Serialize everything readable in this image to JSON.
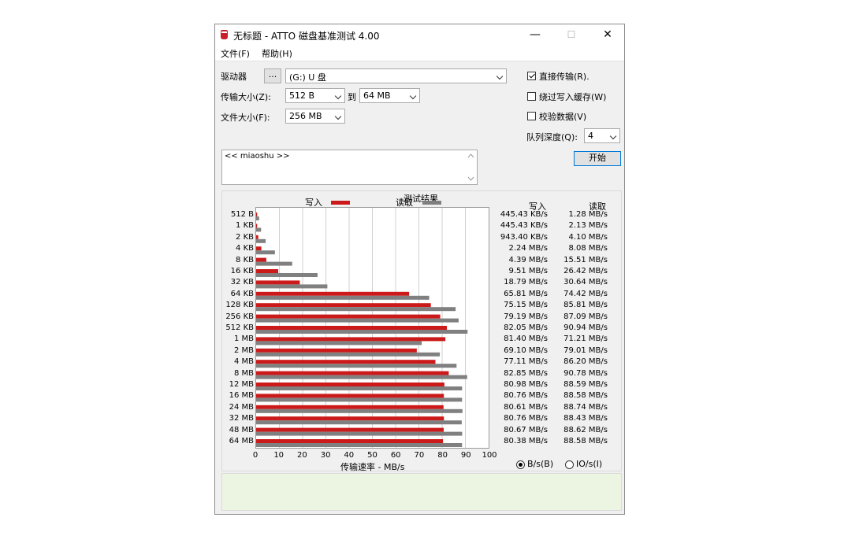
{
  "window": {
    "title": "无标题 - ATTO 磁盘基准测试 4.00",
    "minimize_glyph": "—",
    "maximize_glyph": "☐",
    "close_glyph": "✕"
  },
  "menu": {
    "file": "文件(F)",
    "help": "帮助(H)"
  },
  "drive": {
    "label": "驱动器",
    "browse": "...",
    "value": "(G:) U 盘"
  },
  "transfer": {
    "label": "传输大小(Z):",
    "from": "512 B",
    "to_label": "到",
    "to": "64 MB"
  },
  "filesize": {
    "label": "文件大小(F):",
    "value": "256 MB"
  },
  "options": {
    "direct_io": {
      "label": "直接传输(R).",
      "checked": true
    },
    "bypass_cache": {
      "label": "绕过写入缓存(W)",
      "checked": false
    },
    "verify": {
      "label": "校验数据(V)",
      "checked": false
    },
    "queue_label": "队列深度(Q):",
    "queue_value": "4"
  },
  "start_button": "开始",
  "description": "<< miaoshu >>",
  "colors": {
    "write": "#cc1a1a",
    "read": "#808080"
  },
  "results": {
    "write_header": "写入",
    "read_header": "读取",
    "rows": [
      {
        "size": "512 B",
        "write": "445.43 KB/s",
        "read": "1.28 MB/s"
      },
      {
        "size": "1 KB",
        "write": "445.43 KB/s",
        "read": "2.13 MB/s"
      },
      {
        "size": "2 KB",
        "write": "943.40 KB/s",
        "read": "4.10 MB/s"
      },
      {
        "size": "4 KB",
        "write": "2.24 MB/s",
        "read": "8.08 MB/s"
      },
      {
        "size": "8 KB",
        "write": "4.39 MB/s",
        "read": "15.51 MB/s"
      },
      {
        "size": "16 KB",
        "write": "9.51 MB/s",
        "read": "26.42 MB/s"
      },
      {
        "size": "32 KB",
        "write": "18.79 MB/s",
        "read": "30.64 MB/s"
      },
      {
        "size": "64 KB",
        "write": "65.81 MB/s",
        "read": "74.42 MB/s"
      },
      {
        "size": "128 KB",
        "write": "75.15 MB/s",
        "read": "85.81 MB/s"
      },
      {
        "size": "256 KB",
        "write": "79.19 MB/s",
        "read": "87.09 MB/s"
      },
      {
        "size": "512 KB",
        "write": "82.05 MB/s",
        "read": "90.94 MB/s"
      },
      {
        "size": "1 MB",
        "write": "81.40 MB/s",
        "read": "71.21 MB/s"
      },
      {
        "size": "2 MB",
        "write": "69.10 MB/s",
        "read": "79.01 MB/s"
      },
      {
        "size": "4 MB",
        "write": "77.11 MB/s",
        "read": "86.20 MB/s"
      },
      {
        "size": "8 MB",
        "write": "82.85 MB/s",
        "read": "90.78 MB/s"
      },
      {
        "size": "12 MB",
        "write": "80.98 MB/s",
        "read": "88.59 MB/s"
      },
      {
        "size": "16 MB",
        "write": "80.76 MB/s",
        "read": "88.58 MB/s"
      },
      {
        "size": "24 MB",
        "write": "80.61 MB/s",
        "read": "88.74 MB/s"
      },
      {
        "size": "32 MB",
        "write": "80.76 MB/s",
        "read": "88.43 MB/s"
      },
      {
        "size": "48 MB",
        "write": "80.67 MB/s",
        "read": "88.62 MB/s"
      },
      {
        "size": "64 MB",
        "write": "80.38 MB/s",
        "read": "88.58 MB/s"
      }
    ]
  },
  "units": {
    "bytes": "B/s(B)",
    "io": "IO/s(I)",
    "selected": "bytes"
  },
  "chart_data": {
    "type": "bar",
    "title": "测试结果",
    "xlabel": "传输速率 - MB/s",
    "ylabel": "",
    "xlim": [
      0,
      100
    ],
    "xticks": [
      0,
      10,
      20,
      30,
      40,
      50,
      60,
      70,
      80,
      90,
      100
    ],
    "orientation": "horizontal",
    "grid": true,
    "legend": "top",
    "categories": [
      "512 B",
      "1 KB",
      "2 KB",
      "4 KB",
      "8 KB",
      "16 KB",
      "32 KB",
      "64 KB",
      "128 KB",
      "256 KB",
      "512 KB",
      "1 MB",
      "2 MB",
      "4 MB",
      "8 MB",
      "12 MB",
      "16 MB",
      "24 MB",
      "32 MB",
      "48 MB",
      "64 MB"
    ],
    "series": [
      {
        "name": "写入",
        "values": [
          0.43,
          0.43,
          0.92,
          2.24,
          4.39,
          9.51,
          18.79,
          65.81,
          75.15,
          79.19,
          82.05,
          81.4,
          69.1,
          77.11,
          82.85,
          80.98,
          80.76,
          80.61,
          80.76,
          80.67,
          80.38
        ]
      },
      {
        "name": "读取",
        "values": [
          1.28,
          2.13,
          4.1,
          8.08,
          15.51,
          26.42,
          30.64,
          74.42,
          85.81,
          87.09,
          90.94,
          71.21,
          79.01,
          86.2,
          90.78,
          88.59,
          88.58,
          88.74,
          88.43,
          88.62,
          88.58
        ]
      }
    ]
  }
}
